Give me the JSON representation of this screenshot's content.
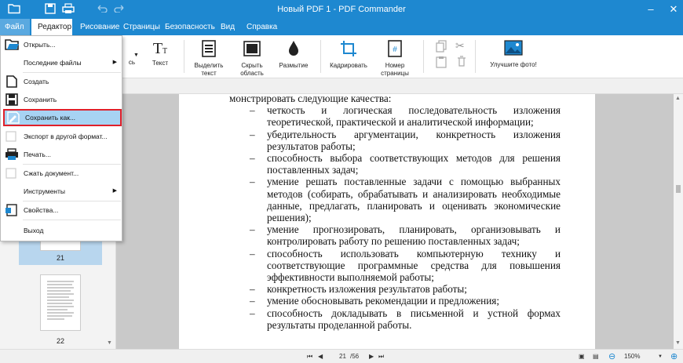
{
  "window": {
    "title": "Новый PDF 1 - PDF Commander"
  },
  "menubar": {
    "file_label": "Файл",
    "tabs": [
      "Редактор",
      "Рисование",
      "Страницы",
      "Безопасность",
      "Вид",
      "Справка"
    ]
  },
  "ribbon": {
    "partial_label": "сь",
    "text_label": "Текст",
    "highlight_label": "Выделить текст",
    "hide_label": "Скрыть область",
    "blur_label": "Размытие",
    "crop_label": "Кадрировать",
    "page_number_label": "Номер страницы",
    "enhance_label": "Улучшите фото!"
  },
  "file_menu": {
    "items": [
      {
        "label": "Открыть...",
        "icon": "folder-open-icon"
      },
      {
        "label": "Последние файлы",
        "icon": "",
        "submenu": true
      },
      {
        "label": "Создать",
        "icon": "new-document-icon"
      },
      {
        "label": "Сохранить",
        "icon": "save-icon"
      },
      {
        "label": "Сохранить как...",
        "icon": "save-as-icon",
        "highlighted": true
      },
      {
        "label": "Экспорт в другой формат...",
        "icon": "export-icon"
      },
      {
        "label": "Печать...",
        "icon": "printer-icon"
      },
      {
        "label": "Сжать документ...",
        "icon": "compress-icon"
      },
      {
        "label": "Инструменты",
        "icon": "",
        "submenu": true
      },
      {
        "label": "Свойства...",
        "icon": "properties-icon"
      },
      {
        "label": "Выход",
        "icon": ""
      }
    ]
  },
  "thumbnails": {
    "pages": [
      "21",
      "22"
    ],
    "selected": "21"
  },
  "document": {
    "intro": "монстрировать следующие качества:",
    "items": [
      "четкость и логическая последовательность изложения теоретической, практической и аналитической информации;",
      "убедительность аргументации, конкретность изложения результатов работы;",
      "способность выбора соответствующих методов для решения поставленных задач;",
      "умение решать поставленные задачи с помощью выбранных методов (собирать, обрабатывать и анализировать необходимые данные, предлагать, планировать и оценивать экономические решения);",
      "умение прогнозировать, планировать, организовывать и контролировать работу по решению поставленных задач;",
      "способность использовать компьютерную технику и соответствующие программные средства для повышения эффективности выполняемой работы;",
      "конкретность изложения результатов работы;",
      "умение обосновывать рекомендации и предложения;",
      "способность докладывать в письменной и устной формах результаты проделанной работы."
    ],
    "dash": "–"
  },
  "status": {
    "current_page": "21",
    "total_pages": "/56",
    "zoom": "150%"
  },
  "colors": {
    "accent": "#1e88d0",
    "highlight": "#a7d3f3",
    "highlight_border": "#e0202a"
  }
}
